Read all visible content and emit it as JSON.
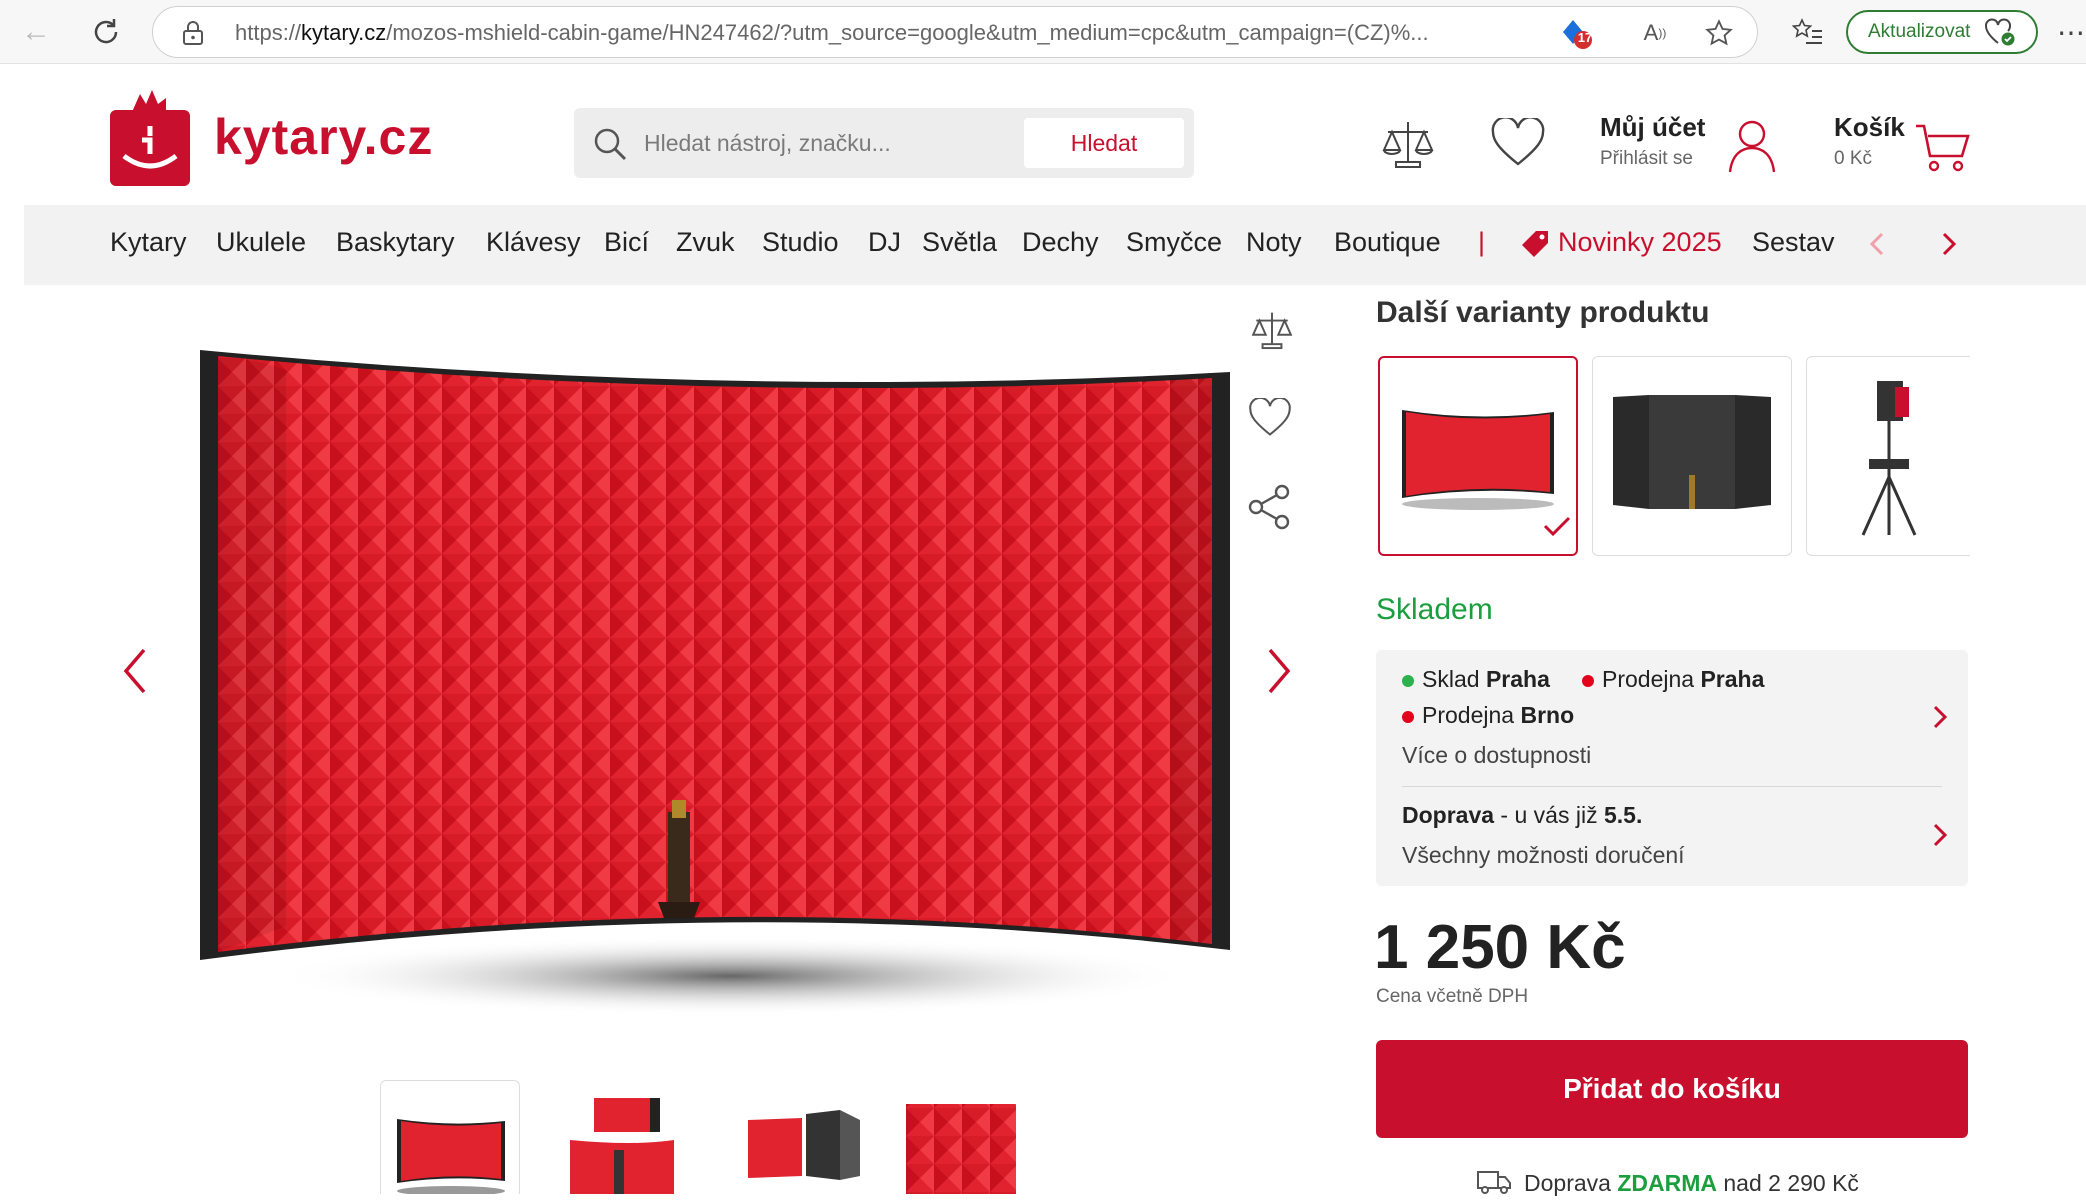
{
  "browser": {
    "url_prefix": "https://",
    "url_domain": "kytary.cz",
    "url_rest": "/mozos-mshield-cabin-game/HN247462/?utm_source=google&utm_medium=cpc&utm_campaign=(CZ)%...",
    "badge_count": "17",
    "update_label": "Aktualizovat"
  },
  "header": {
    "logo_text": "kytary.cz",
    "search_placeholder": "Hledat nástroj, značku...",
    "search_button": "Hledat",
    "account_label": "Můj účet",
    "account_sub": "Přihlásit se",
    "cart_label": "Košík",
    "cart_sub": "0 Kč"
  },
  "nav": {
    "items": [
      "Kytary",
      "Ukulele",
      "Baskytary",
      "Klávesy",
      "Bicí",
      "Zvuk",
      "Studio",
      "DJ",
      "Světla",
      "Dechy",
      "Smyčce",
      "Noty",
      "Boutique"
    ],
    "separator": "|",
    "highlight": "Novinky 2025",
    "truncated": "Sestav"
  },
  "product": {
    "variants_title": "Další varianty produktu",
    "stock": "Skladem",
    "availability": {
      "a_prefix": "Sklad ",
      "a_bold": "Praha",
      "b_prefix": "Prodejna ",
      "b_bold": "Praha",
      "c_prefix": "Prodejna ",
      "c_bold": "Brno",
      "more": "Více o dostupnosti",
      "delivery_bold": "Doprava",
      "delivery_mid": " - u vás již ",
      "delivery_date": "5.5.",
      "delivery_more": "Všechny možnosti doručení"
    },
    "price": "1 250 Kč",
    "price_note": "Cena včetně DPH",
    "add_to_cart": "Přidat do košíku",
    "shipping_prefix": "Doprava ",
    "shipping_free": "ZDARMA",
    "shipping_suffix": " nad 2 290 Kč"
  },
  "colors": {
    "brand": "#c8102e",
    "stock_green": "#1b9e3e",
    "dot_green": "#2bb24c",
    "dot_red": "#e3001b"
  }
}
